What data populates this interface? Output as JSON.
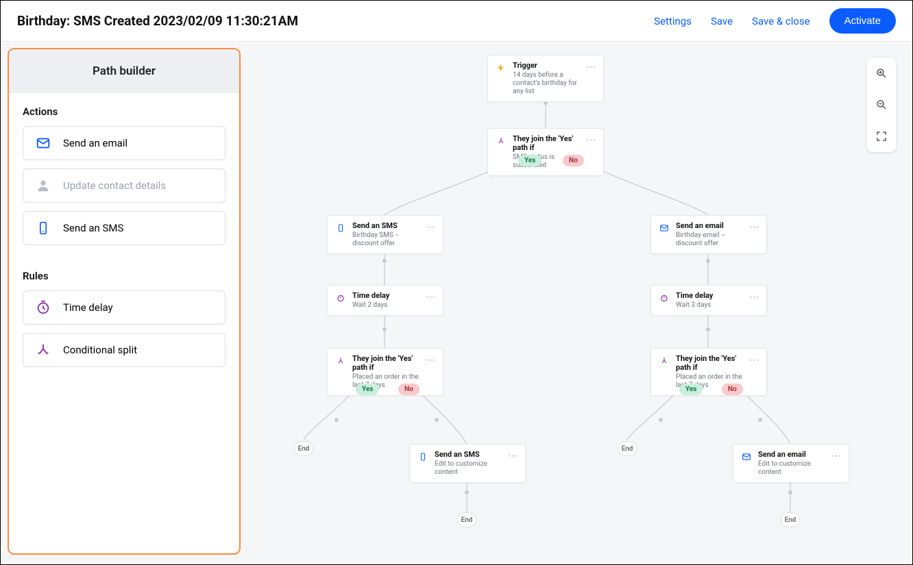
{
  "header": {
    "title": "Birthday: SMS Created 2023/02/09 11:30:21AM",
    "settings": "Settings",
    "save": "Save",
    "save_close": "Save & close",
    "activate": "Activate"
  },
  "sidebar": {
    "title": "Path builder",
    "sections": {
      "actions": {
        "heading": "Actions",
        "items": [
          {
            "label": "Send an email",
            "icon": "mail-icon"
          },
          {
            "label": "Update contact details",
            "icon": "user-icon",
            "disabled": true
          },
          {
            "label": "Send an SMS",
            "icon": "phone-icon"
          }
        ]
      },
      "rules": {
        "heading": "Rules",
        "items": [
          {
            "label": "Time delay",
            "icon": "stopwatch-icon"
          },
          {
            "label": "Conditional split",
            "icon": "split-icon"
          }
        ]
      }
    }
  },
  "flow": {
    "trigger": {
      "title": "Trigger",
      "sub": "14 days before a contact's birthday for any list",
      "icon": "bolt-icon"
    },
    "split1": {
      "title": "They join the 'Yes' path if",
      "sub": "SMS status is subscribed",
      "icon": "split-icon"
    },
    "pill_yes": "Yes",
    "pill_no": "No",
    "left": {
      "sms": {
        "title": "Send an SMS",
        "sub": "Birthday SMS -- discount offer",
        "icon": "phone-icon"
      },
      "delay": {
        "title": "Time delay",
        "sub": "Wait 2 days",
        "icon": "stopwatch-icon"
      },
      "split": {
        "title": "They join the 'Yes' path if",
        "sub": "Placed an order in the last 7 days",
        "icon": "split-icon"
      },
      "sms2": {
        "title": "Send an SMS",
        "sub": "Edit to customize content",
        "icon": "phone-icon"
      }
    },
    "right": {
      "email": {
        "title": "Send an email",
        "sub": "Birthday email -- discount offer",
        "icon": "mail-icon"
      },
      "delay": {
        "title": "Time delay",
        "sub": "Wait 3 days",
        "icon": "stopwatch-icon"
      },
      "split": {
        "title": "They join the 'Yes' path if",
        "sub": "Placed an order in the last 7 days",
        "icon": "split-icon"
      },
      "email2": {
        "title": "Send an email",
        "sub": "Edit to customize content",
        "icon": "mail-icon"
      }
    },
    "end": "End"
  },
  "zoom": {
    "in": "zoom-in",
    "out": "zoom-out",
    "fit": "fit-screen"
  }
}
